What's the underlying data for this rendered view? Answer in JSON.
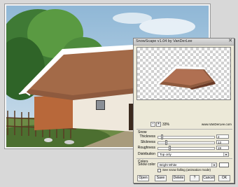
{
  "dialog": {
    "title": "SnowScape v1.04 by VanDerLee",
    "close": "✕"
  },
  "zoom": {
    "minus": "−",
    "plus": "+",
    "level": "33%",
    "url": "www.VanDerLee.com"
  },
  "snow": {
    "section_label": "Snow",
    "thickness": {
      "label": "Thickness",
      "value": "2",
      "fraction": 0.05
    },
    "slickness": {
      "label": "Slickness",
      "value": "13",
      "fraction": 0.13
    },
    "roughness": {
      "label": "Roughness",
      "value": "19",
      "fraction": 0.19
    },
    "distribution": {
      "label": "Distribution",
      "value": "Top only"
    }
  },
  "colors": {
    "section_label": "Colors",
    "snow_color": {
      "label": "Snow color",
      "value": "Bright White",
      "swatch": "#ffffff"
    }
  },
  "animation": {
    "label": "See snow falling (animation mode)"
  },
  "buttons": {
    "open": "Open",
    "save": "Save",
    "delete": "Delete",
    "help": "?",
    "cancel": "Cancel",
    "ok": "OK"
  }
}
